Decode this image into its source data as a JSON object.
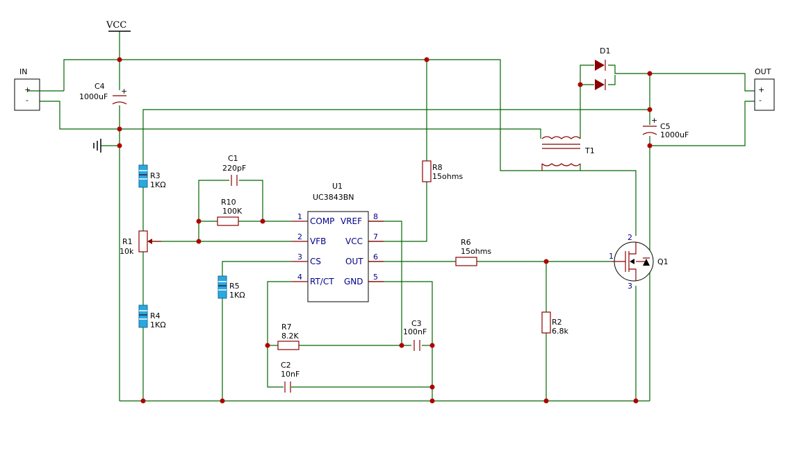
{
  "power": {
    "vcc_label": "VCC"
  },
  "connectors": {
    "in": {
      "label": "IN",
      "plus": "+",
      "minus": "-"
    },
    "out": {
      "label": "OUT",
      "plus": "+",
      "minus": "-"
    }
  },
  "ic": {
    "ref": "U1",
    "part": "UC3843BN",
    "pins": [
      {
        "num": "1",
        "name": "COMP"
      },
      {
        "num": "2",
        "name": "VFB"
      },
      {
        "num": "3",
        "name": "CS"
      },
      {
        "num": "4",
        "name": "RT/CT"
      },
      {
        "num": "8",
        "name": "VREF"
      },
      {
        "num": "7",
        "name": "VCC"
      },
      {
        "num": "6",
        "name": "OUT"
      },
      {
        "num": "5",
        "name": "GND"
      }
    ]
  },
  "components": {
    "C1": {
      "ref": "C1",
      "value": "220pF"
    },
    "C2": {
      "ref": "C2",
      "value": "10nF"
    },
    "C3": {
      "ref": "C3",
      "value": "100nF"
    },
    "C4": {
      "ref": "C4",
      "value": "1000uF"
    },
    "C5": {
      "ref": "C5",
      "value": "1000uF"
    },
    "R1": {
      "ref": "R1",
      "value": "10k"
    },
    "R2": {
      "ref": "R2",
      "value": "6.8k"
    },
    "R3": {
      "ref": "R3",
      "value": "1KΩ"
    },
    "R4": {
      "ref": "R4",
      "value": "1KΩ"
    },
    "R5": {
      "ref": "R5",
      "value": "1KΩ"
    },
    "R6": {
      "ref": "R6",
      "value": "15ohms"
    },
    "R7": {
      "ref": "R7",
      "value": "8.2K"
    },
    "R8": {
      "ref": "R8",
      "value": "15ohms"
    },
    "R10": {
      "ref": "R10",
      "value": "100K"
    },
    "D1": {
      "ref": "D1"
    },
    "T1": {
      "ref": "T1"
    },
    "Q1": {
      "ref": "Q1",
      "pin_gate": "1",
      "pin_drain": "2",
      "pin_source": "3"
    }
  },
  "colors": {
    "wire": "#006600",
    "component": "#8b0000",
    "junction": "#b00000",
    "pin_text": "#000088",
    "resistor_fill": "#2aa8e0"
  }
}
